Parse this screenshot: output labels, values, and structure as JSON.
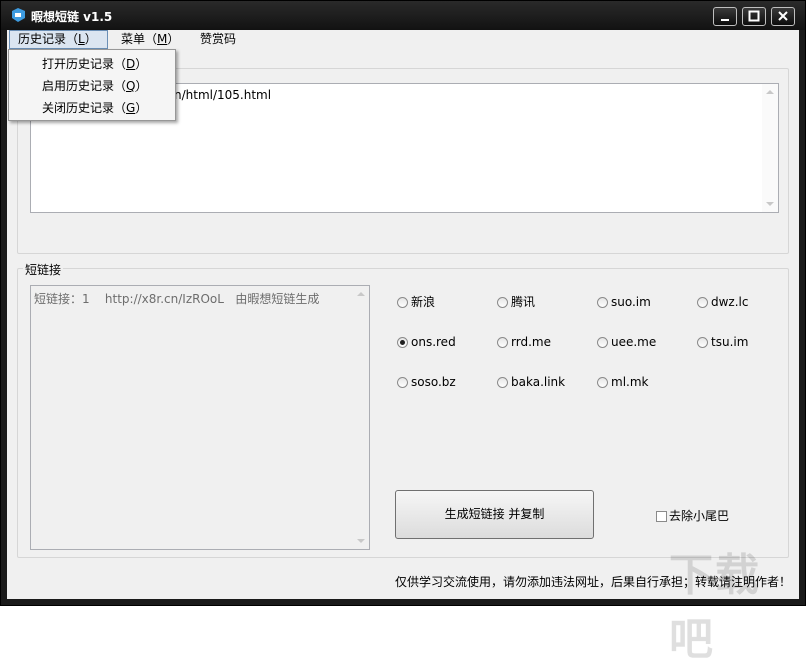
{
  "window": {
    "title": "暇想短链 v1.5"
  },
  "menu": {
    "history": {
      "label": "历史记录（",
      "key": "L",
      "close": "）"
    },
    "menu": {
      "label": "菜单（",
      "key": "M",
      "close": "）"
    },
    "appreciate": {
      "label": "赞赏码"
    }
  },
  "history_dropdown": {
    "items": [
      {
        "label": "打开历史记录（",
        "key": "D",
        "close": "）"
      },
      {
        "label": "启用历史记录（",
        "key": "Q",
        "close": "）"
      },
      {
        "label": "关闭历史记录（",
        "key": "G",
        "close": "）"
      }
    ]
  },
  "input": {
    "url_text": "n/html/105.html"
  },
  "short_link": {
    "group_label": "短链接",
    "result_text": "短链接：1    http://x8r.cn/IzROoL   由暇想短链生成"
  },
  "services": [
    {
      "label": "新浪",
      "checked": false
    },
    {
      "label": "腾讯",
      "checked": false
    },
    {
      "label": "suo.im",
      "checked": false
    },
    {
      "label": "dwz.lc",
      "checked": false
    },
    {
      "label": "ons.red",
      "checked": true
    },
    {
      "label": "rrd.me",
      "checked": false
    },
    {
      "label": "uee.me",
      "checked": false
    },
    {
      "label": "tsu.im",
      "checked": false
    },
    {
      "label": "soso.bz",
      "checked": false
    },
    {
      "label": "baka.link",
      "checked": false
    },
    {
      "label": "ml.mk",
      "checked": false
    }
  ],
  "actions": {
    "generate_label": "生成短链接 并复制",
    "remove_tail_label": "去除小尾巴",
    "remove_tail_checked": false
  },
  "footer": {
    "notice": "仅供学习交流使用，请勿添加违法网址，后果自行承担；转载请注明作者！"
  },
  "watermark": {
    "text": "下载吧"
  },
  "colors": {
    "titlebar": "#1a1a1a",
    "client_bg": "#f0f0f0",
    "menu_active_border": "#6b8fb6"
  }
}
